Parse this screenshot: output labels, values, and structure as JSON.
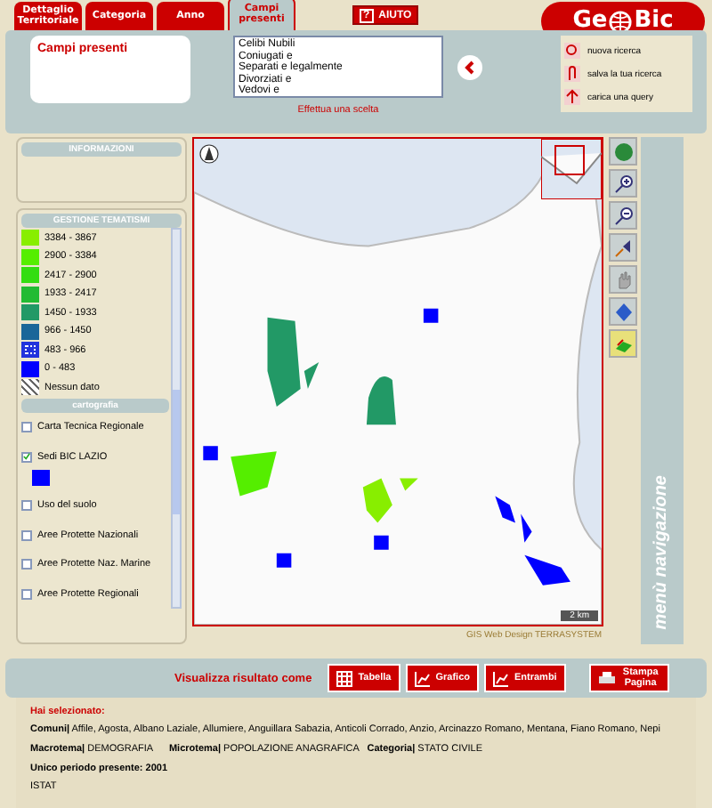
{
  "tabs": [
    {
      "label": "Dettaglio Territoriale",
      "selected": false
    },
    {
      "label": "Categoria",
      "selected": false
    },
    {
      "label": "Anno",
      "selected": false
    },
    {
      "label": "Campi presenti",
      "selected": true
    }
  ],
  "help_button": {
    "icon": "?",
    "label": "AIUTO"
  },
  "logo": {
    "left": "Ge",
    "right": "Bic"
  },
  "fields_panel": {
    "title": "Campi presenti",
    "hint": "Effettua una scelta",
    "options": [
      {
        "label": "Celibi Nubili",
        "selected": false
      },
      {
        "label": "Coniugati e",
        "selected": false
      },
      {
        "label": "Separati e legalmente",
        "selected": false
      },
      {
        "label": "Divorziati e",
        "selected": false
      },
      {
        "label": "Vedovi e",
        "selected": false
      }
    ]
  },
  "actions": [
    "nuova ricerca",
    "salva la tua ricerca",
    "carica una query"
  ],
  "info_panel": {
    "title": "INFORMAZIONI"
  },
  "legend": {
    "title": "GESTIONE TEMATISMI",
    "items": [
      {
        "kind": "solid",
        "label": "3384 - 3867",
        "color": "#88ee00"
      },
      {
        "kind": "solid",
        "label": "2900 - 3384",
        "color": "#55ee00"
      },
      {
        "kind": "solid",
        "label": "2417 - 2900",
        "color": "#33dd11"
      },
      {
        "kind": "solid",
        "label": "1933 - 2417",
        "color": "#22bb33"
      },
      {
        "kind": "solid",
        "label": "1450 - 1933",
        "color": "#229966"
      },
      {
        "kind": "solid",
        "label": "966 - 1450",
        "color": "#1a6699"
      },
      {
        "kind": "dotted",
        "label": "483 - 966",
        "color": "#2233dd"
      },
      {
        "kind": "solid",
        "label": "0 - 483",
        "color": "#0000ff"
      },
      {
        "kind": "hatched",
        "label": "Nessun dato",
        "color": "#666666"
      }
    ]
  },
  "layers": {
    "title": "cartografia",
    "items": [
      {
        "label": "Carta Tecnica Regionale",
        "checked": false
      },
      {
        "label": "Sedi BIC LAZIO",
        "checked": true,
        "color": "#0000ff"
      },
      {
        "label": "Uso del suolo",
        "checked": false
      },
      {
        "label": "Aree Protette Nazionali",
        "checked": false
      },
      {
        "label": "Aree Protette Naz. Marine",
        "checked": false
      },
      {
        "label": "Aree Protette Regionali",
        "checked": false
      }
    ]
  },
  "map": {
    "scale": "2 km",
    "credit": "GIS Web Design TERRASYSTEM"
  },
  "nav_menu": {
    "title": "menù navigazione"
  },
  "results_bar": {
    "label": "Visualizza risultato come",
    "buttons": [
      "Tabella",
      "Grafico",
      "Entrambi"
    ],
    "print": "Stampa Pagina"
  },
  "selection": {
    "title": "Hai selezionato:",
    "lines": [
      "**Comuni|** Affile, Agosta, Albano Laziale, Allumiere, Anguillara Sabazia, Anticoli Corrado, Anzio, Arcinazzo Romano, Mentana, Fiano Romano, Nepi",
      "**Macrotema|** DEMOGRAFIA      **Microtema|** POPOLAZIONE ANAGRAFICA   **Categoria|** STATO CIVILE"
    ],
    "period": "Unico periodo presente: 2001",
    "source": "ISTAT"
  }
}
